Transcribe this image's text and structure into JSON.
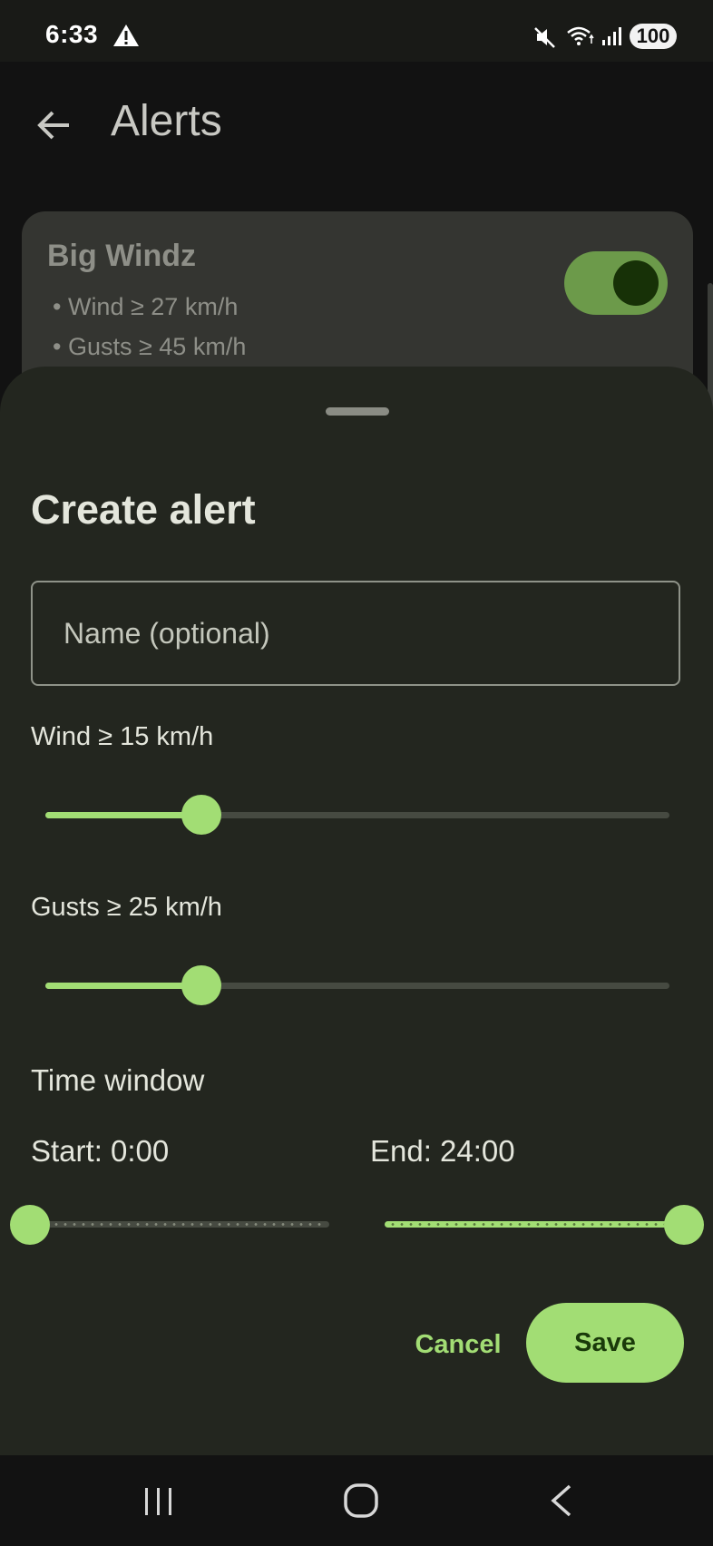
{
  "status_bar": {
    "time": "6:33",
    "battery": "100",
    "icons": [
      "warning-icon",
      "mute-icon",
      "wifi-icon",
      "signal-icon"
    ]
  },
  "app_bar": {
    "title": "Alerts",
    "back_icon": "arrow-left-icon"
  },
  "alert_card": {
    "name": "Big Windz",
    "conditions": [
      "• Wind ≥ 27 km/h",
      "• Gusts ≥ 45 km/h"
    ],
    "enabled": true
  },
  "sheet": {
    "title": "Create alert",
    "name_field": {
      "placeholder": "Name (optional)",
      "value": ""
    },
    "wind": {
      "label": "Wind ≥ 15 km/h",
      "value_fraction": 0.25
    },
    "gusts": {
      "label": "Gusts ≥ 25 km/h",
      "value_fraction": 0.25
    },
    "time_window": {
      "heading": "Time window",
      "start_label": "Start: 0:00",
      "end_label": "End: 24:00",
      "start_fraction": 0.0,
      "end_fraction": 1.0
    },
    "cancel_label": "Cancel",
    "save_label": "Save"
  },
  "nav_bar": {
    "icons": [
      "recents-icon",
      "home-icon",
      "back-icon"
    ]
  },
  "colors": {
    "accent": "#a2dd74",
    "sheet_background": "#23261f",
    "background": "#121212",
    "card": "#343531"
  }
}
